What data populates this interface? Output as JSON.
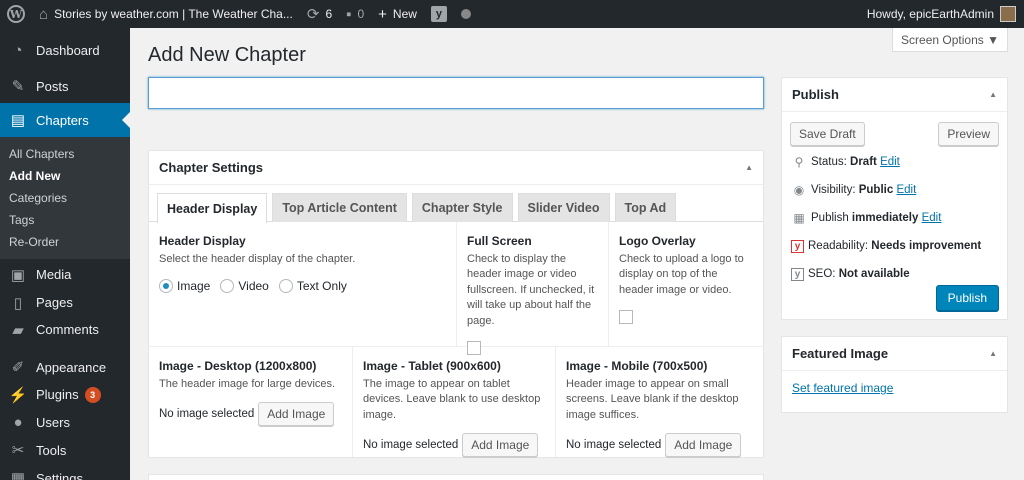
{
  "adminbar": {
    "site_name": "Stories by weather.com | The Weather Cha...",
    "updates_count": "6",
    "comments_count": "0",
    "new_label": "New",
    "greeting": "Howdy, epicEarthAdmin"
  },
  "sidebar": {
    "items": [
      {
        "label": "Dashboard",
        "icon": "dashboard-icon"
      },
      {
        "label": "Posts",
        "icon": "pin-icon"
      },
      {
        "label": "Chapters",
        "icon": "chapters-icon"
      },
      {
        "label": "Media",
        "icon": "media-icon"
      },
      {
        "label": "Pages",
        "icon": "pages-icon"
      },
      {
        "label": "Comments",
        "icon": "comment-icon"
      },
      {
        "label": "Appearance",
        "icon": "brush-icon"
      },
      {
        "label": "Plugins",
        "icon": "plugin-icon",
        "badge": "3"
      },
      {
        "label": "Users",
        "icon": "user-icon"
      },
      {
        "label": "Tools",
        "icon": "wrench-icon"
      },
      {
        "label": "Settings",
        "icon": "settings-icon"
      }
    ],
    "submenu": [
      "All Chapters",
      "Add New",
      "Categories",
      "Tags",
      "Re-Order"
    ]
  },
  "screen_options": "Screen Options ▼",
  "page_title": "Add New Chapter",
  "title_input": {
    "value": "",
    "placeholder": ""
  },
  "chapter_settings": {
    "heading": "Chapter Settings",
    "tabs": [
      "Header Display",
      "Top Article Content",
      "Chapter Style",
      "Slider Video",
      "Top Ad"
    ],
    "header_display": {
      "title": "Header Display",
      "desc": "Select the header display of the chapter.",
      "options": [
        "Image",
        "Video",
        "Text Only"
      ]
    },
    "full_screen": {
      "title": "Full Screen",
      "desc": "Check to display the header image or video fullscreen. If unchecked, it will take up about half the page."
    },
    "logo_overlay": {
      "title": "Logo Overlay",
      "desc": "Check to upload a logo to display on top of the header image or video."
    },
    "images": [
      {
        "title": "Image - Desktop (1200x800)",
        "desc": "The header image for large devices.",
        "status": "No image selected",
        "button": "Add Image"
      },
      {
        "title": "Image - Tablet (900x600)",
        "desc": "The image to appear on tablet devices. Leave blank to use desktop image.",
        "status": "No image selected",
        "button": "Add Image"
      },
      {
        "title": "Image - Mobile (700x500)",
        "desc": "Header image to appear on small screens. Leave blank if the desktop image suffices.",
        "status": "No image selected",
        "button": "Add Image"
      }
    ]
  },
  "publish": {
    "heading": "Publish",
    "save_draft": "Save Draft",
    "preview": "Preview",
    "status_label": "Status:",
    "status_value": "Draft",
    "visibility_label": "Visibility:",
    "visibility_value": "Public",
    "publish_label": "Publish",
    "publish_value": "immediately",
    "edit": "Edit",
    "readability_label": "Readability:",
    "readability_value": "Needs improvement",
    "seo_label": "SEO:",
    "seo_value": "Not available",
    "publish_button": "Publish"
  },
  "featured_image": {
    "heading": "Featured Image",
    "link": "Set featured image"
  },
  "colors": {
    "admin_dark": "#23282d",
    "accent": "#0073aa",
    "primary_button": "#0085ba",
    "readability_red": "#dc3232"
  }
}
